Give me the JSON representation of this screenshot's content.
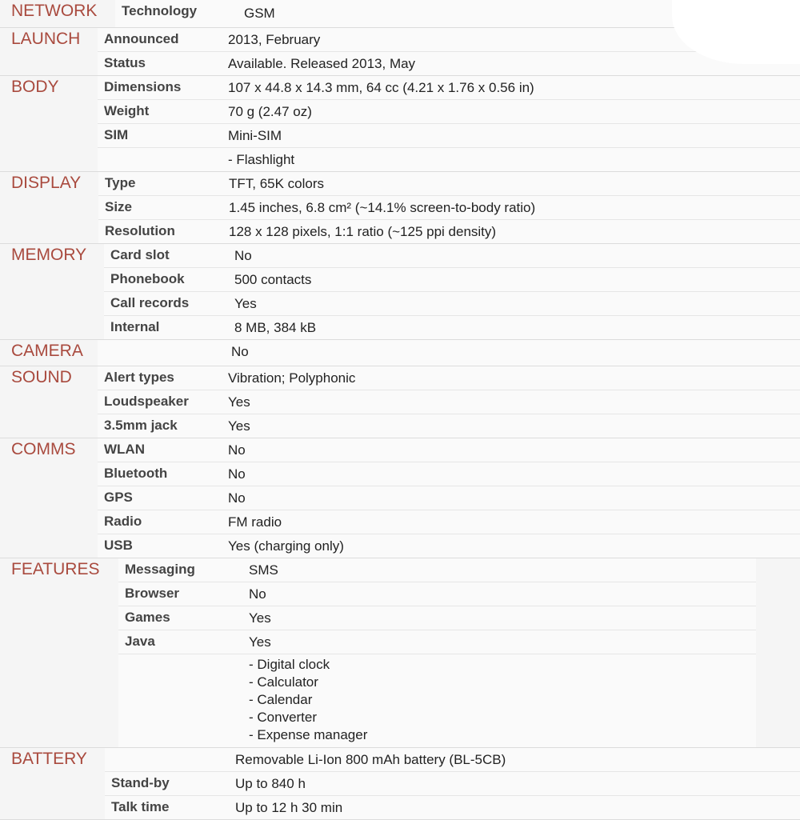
{
  "colors": {
    "section_title": "#a94a3e",
    "label": "#444444",
    "value": "#222222"
  },
  "sections": [
    {
      "title": "NETWORK",
      "rows": [
        {
          "label": "Technology",
          "value": "GSM"
        }
      ]
    },
    {
      "title": "LAUNCH",
      "rows": [
        {
          "label": "Announced",
          "value": "2013, February"
        },
        {
          "label": "Status",
          "value": "Available. Released 2013, May"
        }
      ]
    },
    {
      "title": "BODY",
      "rows": [
        {
          "label": "Dimensions",
          "value": "107 x 44.8 x 14.3 mm, 64 cc (4.21 x 1.76 x 0.56 in)"
        },
        {
          "label": "Weight",
          "value": "70 g (2.47 oz)"
        },
        {
          "label": "SIM",
          "value": "Mini-SIM"
        },
        {
          "label": "",
          "value": "- Flashlight"
        }
      ]
    },
    {
      "title": "DISPLAY",
      "rows": [
        {
          "label": "Type",
          "value": "TFT, 65K colors"
        },
        {
          "label": "Size",
          "value": "1.45 inches, 6.8 cm² (~14.1% screen-to-body ratio)"
        },
        {
          "label": "Resolution",
          "value": "128 x 128 pixels, 1:1 ratio (~125 ppi density)"
        }
      ]
    },
    {
      "title": "MEMORY",
      "rows": [
        {
          "label": "Card slot",
          "value": "No"
        },
        {
          "label": "Phonebook",
          "value": "500 contacts"
        },
        {
          "label": "Call records",
          "value": "Yes"
        },
        {
          "label": "Internal",
          "value": "8 MB, 384 kB"
        }
      ]
    },
    {
      "title": "CAMERA",
      "rows": [
        {
          "label": "",
          "value": "No"
        }
      ]
    },
    {
      "title": "SOUND",
      "rows": [
        {
          "label": "Alert types",
          "value": "Vibration; Polyphonic"
        },
        {
          "label": "Loudspeaker",
          "value": "Yes"
        },
        {
          "label": "3.5mm jack",
          "value": "Yes"
        }
      ]
    },
    {
      "title": "COMMS",
      "rows": [
        {
          "label": "WLAN",
          "value": "No"
        },
        {
          "label": "Bluetooth",
          "value": "No"
        },
        {
          "label": "GPS",
          "value": "No"
        },
        {
          "label": "Radio",
          "value": "FM radio"
        },
        {
          "label": "USB",
          "value": "Yes (charging only)"
        }
      ]
    },
    {
      "title": "FEATURES",
      "rows": [
        {
          "label": "Messaging",
          "value": "SMS"
        },
        {
          "label": "Browser",
          "value": "No"
        },
        {
          "label": "Games",
          "value": "Yes"
        },
        {
          "label": "Java",
          "value": "Yes"
        },
        {
          "label": "",
          "lines": [
            "- Digital clock",
            "- Calculator",
            "- Calendar",
            "- Converter",
            "- Expense manager"
          ]
        }
      ]
    },
    {
      "title": "BATTERY",
      "rows": [
        {
          "label": "",
          "value": "Removable Li-Ion 800 mAh battery (BL-5CB)"
        },
        {
          "label": "Stand-by",
          "value": "Up to 840 h"
        },
        {
          "label": "Talk time",
          "value": "Up to 12 h 30 min"
        }
      ]
    }
  ]
}
